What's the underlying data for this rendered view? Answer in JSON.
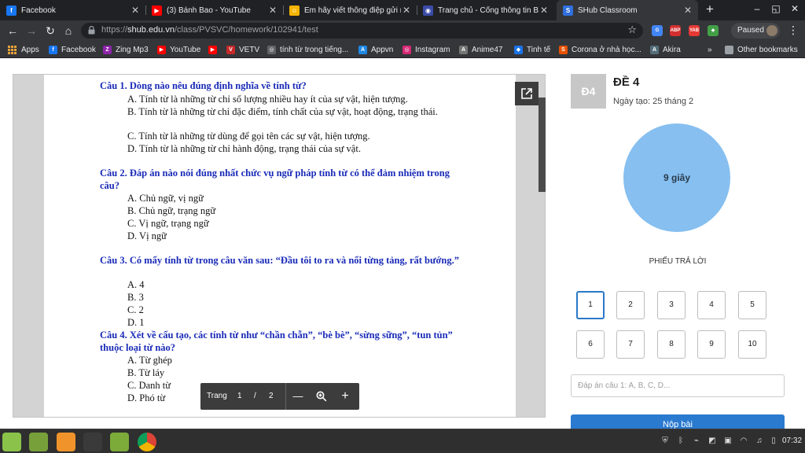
{
  "browser": {
    "tabs": [
      {
        "title": "Facebook",
        "icon": "facebook-icon",
        "color": "#1877f2",
        "glyph": "f",
        "active": false
      },
      {
        "title": "(3) Bánh Bao - YouTube",
        "icon": "youtube-icon",
        "color": "#ff0000",
        "glyph": "▶",
        "active": false
      },
      {
        "title": "Em hãy viết thông điệp gửi mộ",
        "icon": "hoc24-icon",
        "color": "#f5b400",
        "glyph": "☺",
        "active": false
      },
      {
        "title": "Trang chủ - Cổng thông tin Bộ",
        "icon": "portal-icon",
        "color": "#3b4ba8",
        "glyph": "◉",
        "active": false
      },
      {
        "title": "SHub Classroom",
        "icon": "shub-icon",
        "color": "#2f6fde",
        "glyph": "S",
        "active": true
      }
    ],
    "window_controls": {
      "minimize": "–",
      "maximize": "◱",
      "close": "✕"
    },
    "omnibox": {
      "scheme": "https://",
      "host": "shub.edu.vn",
      "path": "/class/PVSVC/homework/102941/test"
    },
    "extensions": [
      {
        "icon": "translate-icon",
        "color": "#4285f4",
        "glyph": "G"
      },
      {
        "icon": "abp-icon",
        "color": "#d32f2f",
        "glyph": "ABP"
      },
      {
        "icon": "yab-icon",
        "color": "#e53935",
        "glyph": "YAB"
      },
      {
        "icon": "extension-icon",
        "color": "#43a047",
        "glyph": "◆"
      },
      {
        "icon": "puzzle-icon",
        "color": "#5f6368",
        "glyph": "✱"
      }
    ],
    "profile_status": "Paused",
    "bookmarks": [
      {
        "label": "Apps",
        "icon": "apps-grid-icon",
        "color": "#e8a33d",
        "glyph": ""
      },
      {
        "label": "Facebook",
        "icon": "facebook-icon",
        "color": "#1877f2",
        "glyph": "f"
      },
      {
        "label": "Zing Mp3",
        "icon": "zing-icon",
        "color": "#8e24aa",
        "glyph": "Z"
      },
      {
        "label": "YouTube",
        "icon": "youtube-icon",
        "color": "#ff0000",
        "glyph": "▶"
      },
      {
        "label": "",
        "icon": "youtube-icon",
        "color": "#ff0000",
        "glyph": "▶"
      },
      {
        "label": "VETV",
        "icon": "vetv-icon",
        "color": "#c62828",
        "glyph": "V"
      },
      {
        "label": "tính từ trong tiếng...",
        "icon": "globe-icon",
        "color": "#5f6368",
        "glyph": "◎"
      },
      {
        "label": "Appvn",
        "icon": "appvn-icon",
        "color": "#1e88e5",
        "glyph": "A"
      },
      {
        "label": "Instagram",
        "icon": "instagram-icon",
        "color": "#d62976",
        "glyph": "◎"
      },
      {
        "label": "Anime47",
        "icon": "anime-icon",
        "color": "#757575",
        "glyph": "A"
      },
      {
        "label": "Tinh tế",
        "icon": "tinhte-icon",
        "color": "#1a73e8",
        "glyph": "◆"
      },
      {
        "label": "Corona ở nhà học...",
        "icon": "corona-icon",
        "color": "#e65100",
        "glyph": "S"
      },
      {
        "label": "Akira",
        "icon": "akira-icon",
        "color": "#546e7a",
        "glyph": "A"
      }
    ],
    "bookmarks_more": "»",
    "other_bookmarks": "Other bookmarks"
  },
  "document": {
    "questions": [
      {
        "stem": "Câu 1. Dòng nào nêu đúng định nghĩa về tính từ?",
        "options": [
          "A. Tính từ là những từ chỉ số lượng nhiều hay ít của sự vật, hiện tượng.",
          "B. Tính từ là những từ chỉ đặc điểm, tính chất của sự vật, hoạt động, trạng thái.",
          "C. Tính từ là những từ dùng để gọi tên các sự vật, hiện tượng.",
          "D. Tính từ là những từ chỉ hành động, trạng thái của sự vật."
        ]
      },
      {
        "stem": "Câu 2. Đáp án nào nói đúng nhất chức vụ ngữ pháp tính từ có thể đảm nhiệm trong câu?",
        "options": [
          "A. Chủ ngữ, vị ngữ",
          "B. Chủ ngữ, trạng ngữ",
          "C. Vị ngữ, trạng ngữ",
          "D. Vị ngữ"
        ]
      },
      {
        "stem": "Câu 3.  Có mấy tính từ trong câu văn sau: “Đầu tôi to ra và nổi từng tảng, rất bướng.”",
        "options": [
          "A. 4",
          "B. 3",
          "C. 2",
          "D. 1"
        ]
      },
      {
        "stem": "Câu 4. Xét về cấu tạo, các tính từ như “chần chẫn”, “bè bè”, “sừng sững”, “tun tủn” thuộc loại từ nào?",
        "options": [
          "A. Từ ghép",
          "B. Từ láy",
          "C. Danh từ",
          "D. Phó từ"
        ]
      }
    ],
    "pager": {
      "label": "Trang",
      "current": "1",
      "separator": "/",
      "total": "2",
      "zoom_out": "—",
      "zoom_in": "+"
    }
  },
  "panel": {
    "badge": "Đ4",
    "title": "ĐỀ 4",
    "created": "Ngày tạo: 25 tháng 2",
    "timer": "9 giây",
    "sheet_title": "PHIẾU TRẢ LỜI",
    "question_numbers": [
      "1",
      "2",
      "3",
      "4",
      "5",
      "6",
      "7",
      "8",
      "9",
      "10"
    ],
    "selected_question": "1",
    "answer_placeholder": "Đáp án câu 1: A, B, C, D...",
    "submit_label": "Nộp bài",
    "accent": "#2a7ad0",
    "timer_color": "#86bff0"
  },
  "taskbar": {
    "apps": [
      {
        "icon": "mint-menu-icon",
        "color": "#8bc34a"
      },
      {
        "icon": "files-icon",
        "color": "#78a03a"
      },
      {
        "icon": "update-manager-icon",
        "color": "#f0932b"
      },
      {
        "icon": "terminal-icon",
        "color": "#3a3a3a"
      },
      {
        "icon": "folder-icon",
        "color": "#7cab3a"
      },
      {
        "icon": "chrome-icon",
        "color": "#db4437"
      }
    ],
    "clock": "07:32"
  }
}
